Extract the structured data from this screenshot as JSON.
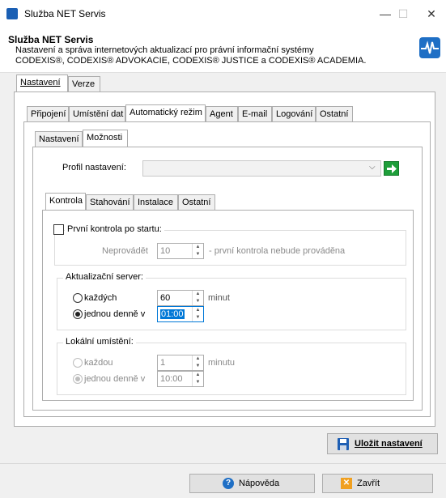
{
  "window": {
    "title": "Služba NET Servis"
  },
  "header": {
    "title": "Služba NET Servis",
    "line1": "Nastavení a správa internetových aktualizací pro právní informační systémy",
    "line2": "CODEXIS®, CODEXIS® ADVOKACIE, CODEXIS® JUSTICE a CODEXIS® ACADEMIA."
  },
  "top_tabs": [
    "Nastavení",
    "Verze"
  ],
  "main_tabs": [
    "Připojení",
    "Umístění dat",
    "Automatický režim",
    "Agent",
    "E-mail",
    "Logování",
    "Ostatní"
  ],
  "sub_tabs": [
    "Nastavení",
    "Možnosti"
  ],
  "profile": {
    "label": "Profil nastavení:",
    "value": ""
  },
  "inner_tabs": [
    "Kontrola",
    "Stahování",
    "Instalace",
    "Ostatní"
  ],
  "first_check": {
    "label": "První kontrola po startu:",
    "checked": false,
    "field_label": "Neprovádět",
    "value": "10",
    "note": "- první kontrola nebude prováděna"
  },
  "update_server": {
    "legend": "Aktualizační server:",
    "every_label": "každých",
    "every_value": "60",
    "every_unit": "minut",
    "daily_label": "jednou denně v",
    "daily_value": "01:00",
    "selected": "daily"
  },
  "local_location": {
    "legend": "Lokální umístění:",
    "every_label": "každou",
    "every_value": "1",
    "every_unit": "minutu",
    "daily_label": "jednou denně v",
    "daily_value": "10:00",
    "selected": "daily"
  },
  "buttons": {
    "save": "Uložit nastavení",
    "help": "Nápověda",
    "close": "Zavřít"
  }
}
